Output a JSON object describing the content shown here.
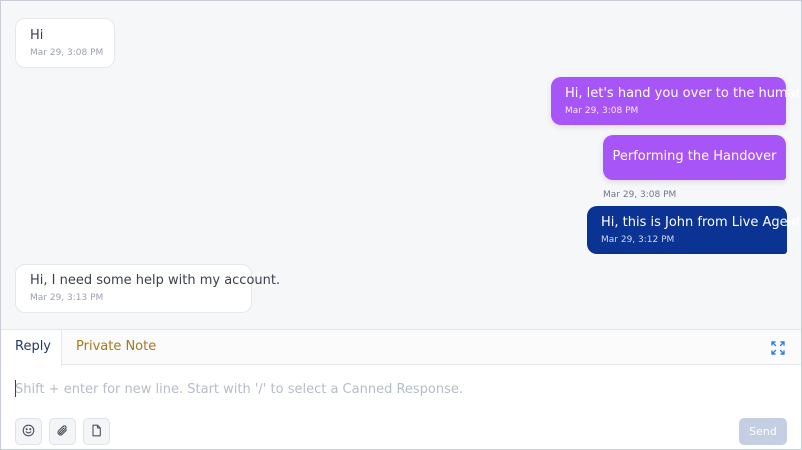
{
  "messages": [
    {
      "sender": "customer",
      "text": "Hi",
      "time": "Mar 29, 3:08 PM"
    },
    {
      "sender": "bot",
      "text": "Hi, let's hand you over to the humans.",
      "time": "Mar 29, 3:08 PM"
    },
    {
      "sender": "bot",
      "text": "Performing the Handover",
      "time": "Mar 29, 3:08 PM"
    },
    {
      "sender": "agent",
      "text": "Hi, this is John from Live Agent.",
      "time": "Mar 29, 3:12 PM"
    },
    {
      "sender": "customer",
      "text": "Hi, I need some help with my account.",
      "time": "Mar 29, 3:13 PM"
    }
  ],
  "reply": {
    "tabs": [
      {
        "label": "Reply",
        "active": true
      },
      {
        "label": "Private Note",
        "active": false
      }
    ],
    "placeholder": "Shift + enter for new line. Start with '/' to select a Canned Response.",
    "tools": [
      "emoji-icon",
      "attachment-icon",
      "document-icon"
    ],
    "send_label": "Send",
    "expand_icon": "expand-icon"
  },
  "colors": {
    "bot_bubble": "#a855f7",
    "agent_bubble": "#0a3393",
    "reply_tab": "#1f3a63",
    "private_note_tab": "#a6791a",
    "send_button": "#c4cfe4"
  }
}
